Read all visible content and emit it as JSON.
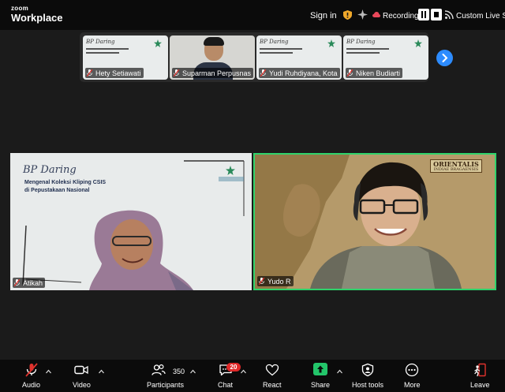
{
  "titlebar": {
    "logo_top": "zoom",
    "logo_bottom": "Workplace",
    "sign_in": "Sign in",
    "recording_label": "Recording...",
    "live_label": "Custom Live Stre"
  },
  "thumbnails": [
    {
      "name": "Hety Setiawati",
      "kind": "slide"
    },
    {
      "name": "Suparman Perpusnas",
      "kind": "person"
    },
    {
      "name": "Yudi Ruhdiyana, Kota",
      "kind": "slide"
    },
    {
      "name": "Niken Budiarti",
      "kind": "slide"
    }
  ],
  "slide": {
    "brand": "BP Daring",
    "title_line1": "Mengenal Koleksi Kliping CSIS",
    "title_line2": "di Pepustakaan Nasional"
  },
  "map": {
    "label_main": "ORIENTALIS",
    "label_sub": "INDIAE BRAGAENSIS"
  },
  "tiles": {
    "left_name": "Atikah",
    "right_name": "Yudo R"
  },
  "toolbar": {
    "audio": "Audio",
    "video": "Video",
    "participants": "Participants",
    "participants_count": "350",
    "chat": "Chat",
    "chat_badge": "20",
    "react": "React",
    "share": "Share",
    "host_tools": "Host tools",
    "more": "More",
    "leave": "Leave"
  },
  "colors": {
    "active_speaker": "#2fd36b",
    "share_green": "#23c56a",
    "badge_red": "#e02828",
    "accent_blue": "#2d8cff",
    "muted_red": "#e0322d"
  }
}
